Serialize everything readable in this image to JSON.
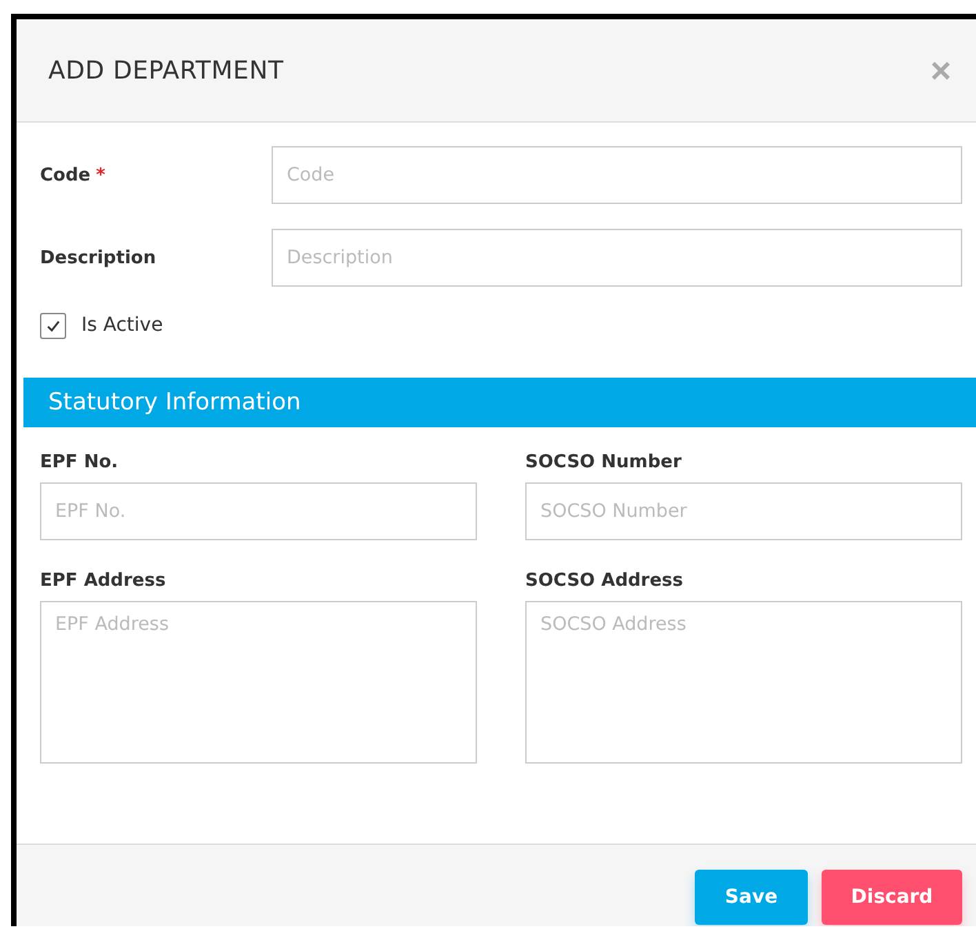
{
  "dialog": {
    "title": "ADD DEPARTMENT",
    "close": "×"
  },
  "fields": [
    {
      "label": "Code",
      "required_mark": "*",
      "placeholder": "Code"
    },
    {
      "label": "Description",
      "placeholder": "Description"
    }
  ],
  "active_checkbox": {
    "label": "Is Active",
    "checked": true
  },
  "section": {
    "title": "Statutory Information",
    "fields": [
      {
        "kind": "input",
        "label": "EPF No.",
        "placeholder": "EPF No."
      },
      {
        "kind": "input",
        "label": "SOCSO Number",
        "placeholder": "SOCSO Number"
      },
      {
        "kind": "textarea",
        "label": "EPF Address",
        "placeholder": "EPF Address"
      },
      {
        "kind": "textarea",
        "label": "SOCSO Address",
        "placeholder": "SOCSO Address"
      }
    ]
  },
  "buttons": [
    {
      "kind": "primary",
      "label": "Save"
    },
    {
      "kind": "danger",
      "label": "Discard"
    }
  ]
}
